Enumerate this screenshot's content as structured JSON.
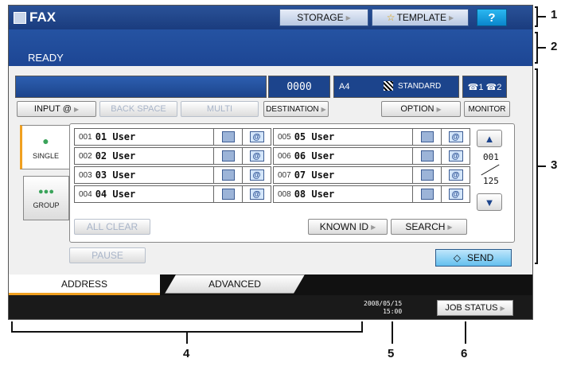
{
  "header": {
    "title": "FAX",
    "storage_label": "STORAGE",
    "template_label": "TEMPLATE",
    "help_label": "?"
  },
  "message": {
    "status": "READY"
  },
  "info": {
    "counter": "0000",
    "paper_size": "A4",
    "resolution": "STANDARD",
    "lines": "☎1 ☎2"
  },
  "controls": {
    "input_label": "INPUT @",
    "backspace_label": "BACK SPACE",
    "multi_label": "MULTI",
    "destination_label": "DESTINATION",
    "option_label": "OPTION",
    "monitor_label": "MONITOR"
  },
  "side_tabs": {
    "single_label": "SINGLE",
    "group_label": "GROUP"
  },
  "entries_left": [
    {
      "no": "001",
      "name": "01 User"
    },
    {
      "no": "002",
      "name": "02 User"
    },
    {
      "no": "003",
      "name": "03 User"
    },
    {
      "no": "004",
      "name": "04 User"
    }
  ],
  "entries_right": [
    {
      "no": "005",
      "name": "05 User"
    },
    {
      "no": "006",
      "name": "06 User"
    },
    {
      "no": "007",
      "name": "07 User"
    },
    {
      "no": "008",
      "name": "08 User"
    }
  ],
  "pager": {
    "current": "001",
    "total": "125"
  },
  "actions": {
    "all_clear_label": "ALL CLEAR",
    "known_id_label": "KNOWN ID",
    "search_label": "SEARCH",
    "pause_label": "PAUSE",
    "send_label": "SEND"
  },
  "bottom_tabs": {
    "address_label": "ADDRESS",
    "advanced_label": "ADVANCED"
  },
  "status": {
    "date": "2008/05/15",
    "time": "15:00",
    "job_status_label": "JOB STATUS"
  },
  "callouts": [
    "1",
    "2",
    "3",
    "4",
    "5",
    "6"
  ],
  "colors": {
    "title_blue": "#1a3c7e",
    "accent_orange": "#f0a020",
    "send_blue": "#64bfee"
  }
}
